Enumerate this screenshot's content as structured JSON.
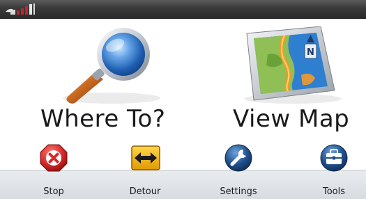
{
  "header": {
    "status_icon": "satellite-signal-icon",
    "status_color": "#c8202a"
  },
  "main": {
    "where_to": {
      "label": "Where To?",
      "icon": "magnifying-glass-icon"
    },
    "view_map": {
      "label": "View Map",
      "icon": "map-icon"
    }
  },
  "toolbar": {
    "stop": {
      "label": "Stop",
      "icon": "stop-icon",
      "color": "#d62a2a"
    },
    "detour": {
      "label": "Detour",
      "icon": "detour-arrows-icon",
      "color": "#f0b400"
    },
    "settings": {
      "label": "Settings",
      "icon": "wrench-icon",
      "color": "#1f4f8a"
    },
    "tools": {
      "label": "Tools",
      "icon": "toolbox-icon",
      "color": "#1f4f8a"
    }
  }
}
